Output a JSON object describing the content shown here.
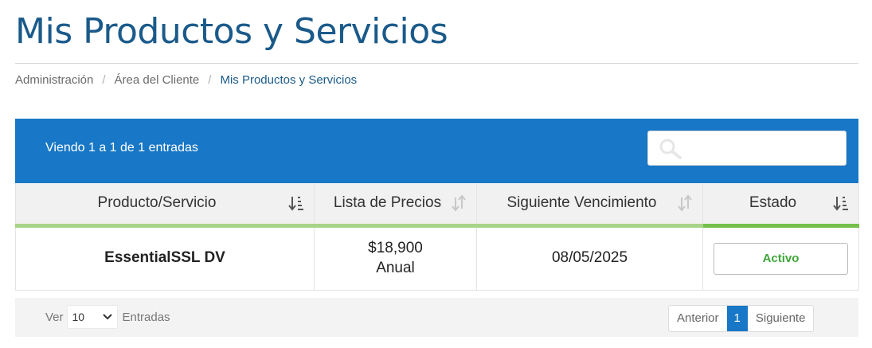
{
  "page": {
    "title": "Mis Productos y Servicios"
  },
  "breadcrumb": {
    "items": [
      "Administración",
      "Área del Cliente",
      "Mis Productos y Servicios"
    ],
    "separator": "/"
  },
  "table": {
    "info": "Viendo 1 a 1 de 1 entradas",
    "search": {
      "value": "",
      "placeholder": ""
    },
    "columns": [
      "Producto/Servicio",
      "Lista de Precios",
      "Siguiente Vencimiento",
      "Estado"
    ],
    "rows": [
      {
        "product": "EssentialSSL DV",
        "price": "$18,900",
        "cycle": "Anual",
        "next_due": "08/05/2025",
        "status": "Activo"
      }
    ],
    "footer": {
      "show_label": "Ver",
      "length_value": "10",
      "entries_label": "Entradas",
      "prev_label": "Anterior",
      "current_page": "1",
      "next_label": "Siguiente"
    }
  },
  "colors": {
    "primary": "#1877c6",
    "title": "#1a5a8a",
    "status_active": "#3fa63a",
    "header_underline": "#74c04a"
  },
  "icons": {
    "search": "search-icon",
    "sort_active": "sort-desc-icon",
    "sort_inactive": "sort-both-icon",
    "select_chevron": "chevron-down-icon"
  }
}
